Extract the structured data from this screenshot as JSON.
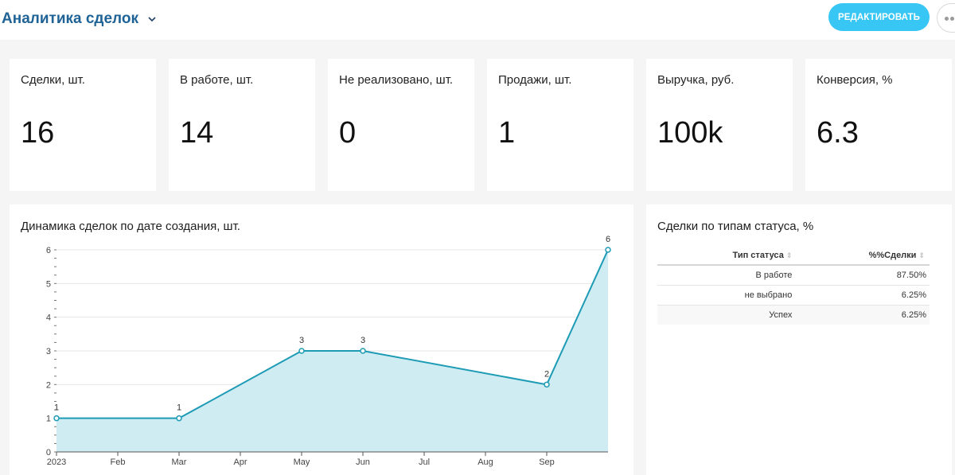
{
  "header": {
    "title": "Аналитика сделок",
    "edit_label": "РЕДАКТИРОВАТЬ"
  },
  "kpis": [
    {
      "label": "Сделки, шт.",
      "value": "16"
    },
    {
      "label": "В работе, шт.",
      "value": "14"
    },
    {
      "label": "Не реализовано, шт.",
      "value": "0"
    },
    {
      "label": "Продажи, шт.",
      "value": "1"
    },
    {
      "label": "Выручка, руб.",
      "value": "100k"
    },
    {
      "label": "Конверсия, %",
      "value": "6.3"
    }
  ],
  "dynamics": {
    "title": "Динамика сделок по дате создания, шт."
  },
  "status_panel": {
    "title": "Сделки по типам статуса, %",
    "columns": [
      "Тип статуса",
      "%%Сделки"
    ],
    "rows": [
      [
        "В работе",
        "87.50%"
      ],
      [
        "не выбрано",
        "6.25%"
      ],
      [
        "Успех",
        "6.25%"
      ]
    ]
  },
  "colors": {
    "accent": "#38c6f4",
    "title": "#1f6396",
    "line": "#1e9bb5",
    "area": "#d0ecf3"
  },
  "chart_data": {
    "type": "area",
    "x": [
      "2023-01",
      "2023-03",
      "2023-05",
      "2023-06",
      "2023-09",
      "2023-10"
    ],
    "values": [
      1,
      1,
      3,
      3,
      2,
      6
    ],
    "data_labels": [
      "1",
      "1",
      "3",
      "3",
      "2",
      "6"
    ],
    "x_ticks": [
      "2023",
      "Feb",
      "Mar",
      "Apr",
      "May",
      "Jun",
      "Jul",
      "Aug",
      "Sep"
    ],
    "y_ticks": [
      "0",
      "1",
      "2",
      "3",
      "4",
      "5",
      "6"
    ],
    "ylim": [
      0,
      6
    ],
    "grid": true
  }
}
